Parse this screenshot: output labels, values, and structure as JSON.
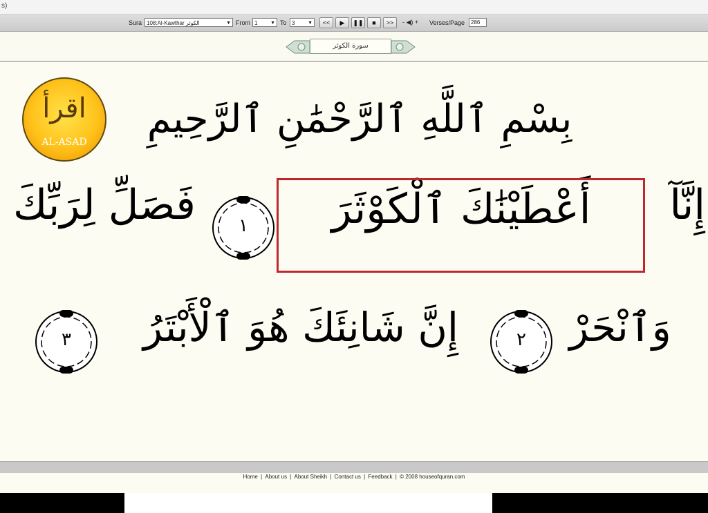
{
  "topstrip": {
    "text": "s)"
  },
  "toolbar": {
    "sura_label": "Sura",
    "sura_value": "108:Al-Kawthar الكوثر",
    "from_label": "From",
    "from_value": "1",
    "to_label": "To",
    "to_value": "3",
    "prev_label": "<<",
    "play_label": "▶",
    "pause_label": "❚❚",
    "stop_label": "■",
    "next_label": ">>",
    "volume": "- ◀) +",
    "verses_label": "Verses/Page",
    "verses_value": "286"
  },
  "surah_header": {
    "title": "سورة الكوثر"
  },
  "logo": {
    "glyph": "اقرأ",
    "name": "AL-ASAD"
  },
  "quran": {
    "bismillah": "بِسْمِ ٱللَّهِ ٱلرَّحْمَٰنِ ٱلرَّحِيمِ",
    "verse1_start": "إِنَّآ",
    "verse1_highlight": "أَعْطَيْنَٰكَ ٱلْكَوْثَرَ",
    "verse2_start": "فَصَلِّ لِرَبِّكَ",
    "verse2_end": "وَٱنْحَرْ",
    "verse3": "إِنَّ شَانِئَكَ هُوَ ٱلْأَبْتَرُ",
    "marker1": "١",
    "marker2": "٢",
    "marker3": "٣"
  },
  "footer": {
    "links": [
      "Home",
      "About us",
      "About Sheikh",
      "Contact us",
      "Feedback"
    ],
    "separator": "|",
    "copyright": "© 2008 houseofquran.com"
  },
  "colors": {
    "highlight": "#c0272d",
    "background": "#fdfcf3"
  }
}
